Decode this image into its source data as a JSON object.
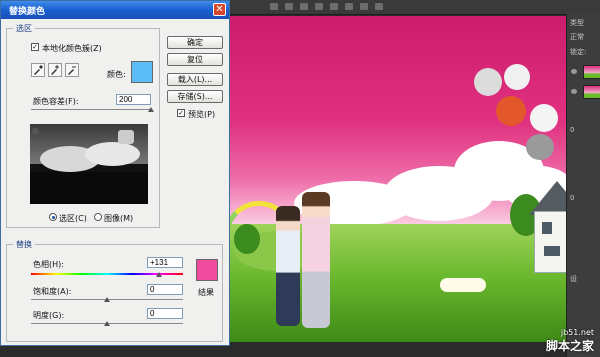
{
  "dialog": {
    "title": "替换颜色",
    "close_glyph": "✕",
    "selection_group": {
      "title": "选区",
      "localized_label": "本地化颜色簇(Z)",
      "localized_checked": true,
      "color_label": "颜色:",
      "color_value": "#5bbcf5",
      "tolerance_label": "颜色容差(F):",
      "tolerance_value": "200",
      "tolerance_level": 1.0,
      "radio_selection": "选区(C)",
      "radio_image": "图像(M)",
      "mode": "selection"
    },
    "replace_group": {
      "title": "替换",
      "hue_label": "色相(H):",
      "hue_value": "+131",
      "saturation_label": "饱和度(A):",
      "saturation_value": "0",
      "lightness_label": "明度(G):",
      "lightness_value": "0",
      "result_label": "结果",
      "result_color": "#f04c9f"
    },
    "buttons": {
      "ok": "确定",
      "reset": "复位",
      "load": "载入(L)...",
      "save": "存储(S)...",
      "preview": "预览(P)"
    },
    "preview_checked": true
  },
  "right_panel": {
    "tab1": "类型",
    "tab2": "正常",
    "lock": "锁定:",
    "num": "0",
    "text_zero": "0",
    "search": "设"
  },
  "watermark": {
    "url": "jb51.net",
    "name": "脚本之家"
  },
  "colors": {
    "dialog_title_bar": "#1b5fd0",
    "sky_top": "#cc1d6c",
    "grass": "#6ab82d"
  }
}
